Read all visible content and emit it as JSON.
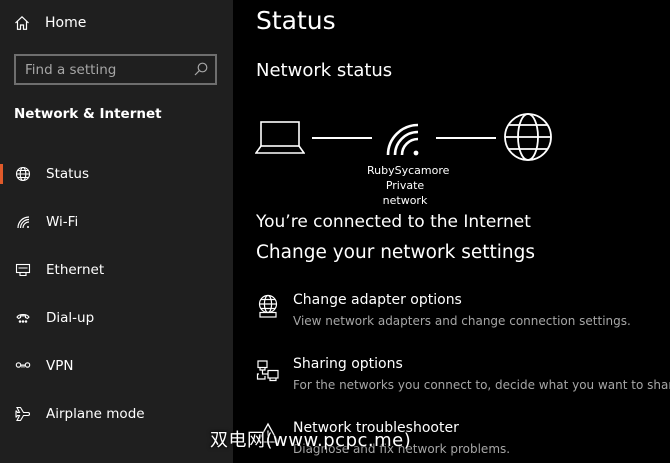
{
  "sidebar": {
    "home_label": "Home",
    "search_placeholder": "Find a setting",
    "section_title": "Network & Internet",
    "accent_color": "#e05a2a",
    "items": [
      {
        "label": "Status",
        "icon": "globe-icon",
        "active": true
      },
      {
        "label": "Wi-Fi",
        "icon": "wifi-icon",
        "active": false
      },
      {
        "label": "Ethernet",
        "icon": "ethernet-icon",
        "active": false
      },
      {
        "label": "Dial-up",
        "icon": "dialup-icon",
        "active": false
      },
      {
        "label": "VPN",
        "icon": "vpn-icon",
        "active": false
      },
      {
        "label": "Airplane mode",
        "icon": "airplane-icon",
        "active": false
      }
    ]
  },
  "main": {
    "title": "Status",
    "network_status_heading": "Network status",
    "network_name": "RubySycamore",
    "network_type": "Private network",
    "connected_text": "You’re connected to the Internet",
    "change_heading": "Change your network settings",
    "options": [
      {
        "title": "Change adapter options",
        "description": "View network adapters and change connection settings.",
        "icon": "adapter-icon"
      },
      {
        "title": "Sharing options",
        "description": "For the networks you connect to, decide what you want to share.",
        "icon": "sharing-icon"
      },
      {
        "title": "Network troubleshooter",
        "description": "Diagnose and fix network problems.",
        "icon": "troubleshooter-icon"
      }
    ]
  },
  "watermark": "双电网(www.pcpc.me)"
}
